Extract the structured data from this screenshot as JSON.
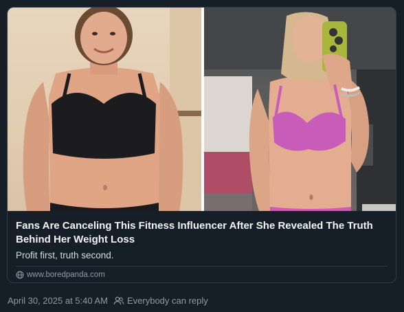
{
  "link_card": {
    "headline": "Fans Are Canceling This Fitness Influencer After She Revealed The Truth Behind Her Weight Loss",
    "description": "Profit first, truth second.",
    "domain": "www.boredpanda.com",
    "domain_icon": "globe-icon"
  },
  "post_meta": {
    "timestamp": "April 30, 2025 at 5:40 AM",
    "reply_icon": "people-icon",
    "reply_setting": "Everybody can reply"
  },
  "colors": {
    "background": "#161e27",
    "card_border": "#2e3c4a",
    "headline": "#f1f3f5",
    "muted": "#8d9aa7"
  }
}
